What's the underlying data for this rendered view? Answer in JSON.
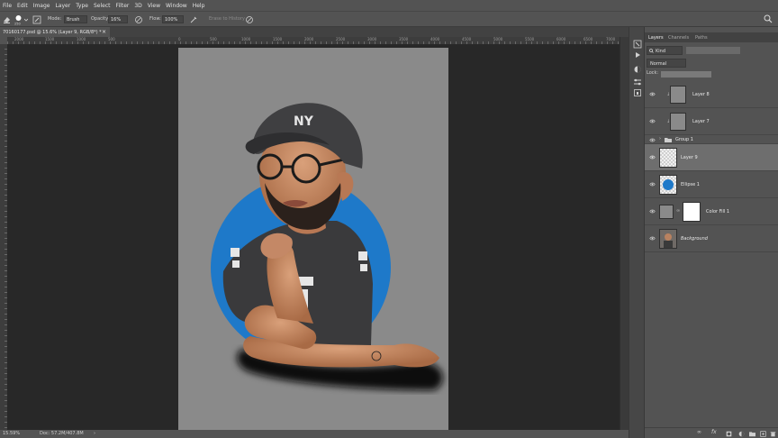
{
  "menu": [
    "File",
    "Edit",
    "Image",
    "Layer",
    "Type",
    "Select",
    "Filter",
    "3D",
    "View",
    "Window",
    "Help"
  ],
  "options_bar": {
    "brush_size": "250",
    "mode_label": "Mode:",
    "mode_value": "Brush",
    "opacity_label": "Opacity:",
    "opacity_value": "16%",
    "flow_label": "Flow:",
    "flow_value": "100%",
    "erase_to_history": "Erase to History"
  },
  "document": {
    "tab_title": "70160177.psd @ 15.6% (Layer 9, RGB/8*) *",
    "ruler_labels": [
      "2000",
      "1500",
      "1000",
      "500",
      "0",
      "500",
      "1000",
      "1500",
      "2000",
      "2500",
      "3000",
      "3500",
      "4000",
      "4500",
      "5000",
      "5500",
      "6000",
      "6500",
      "7000"
    ]
  },
  "status_bar": {
    "zoom": "15.59%",
    "doc_info": "Doc: 57.2M/407.8M"
  },
  "layers_panel": {
    "tabs": [
      "Layers",
      "Channels",
      "Paths"
    ],
    "active_tab": "Layers",
    "kind_label": "Kind",
    "blend_mode": "Normal",
    "lock_label": "Lock:",
    "layers": [
      {
        "name": "Layer 8",
        "type": "layer",
        "selected": false
      },
      {
        "name": "Layer 7",
        "type": "layer",
        "selected": false
      },
      {
        "name": "Group 1",
        "type": "group",
        "selected": false
      },
      {
        "name": "Layer 9",
        "type": "layer",
        "selected": true
      },
      {
        "name": "Ellipse 1",
        "type": "shape",
        "selected": false
      },
      {
        "name": "Color Fill 1",
        "type": "fill",
        "selected": false
      },
      {
        "name": "Background",
        "type": "background",
        "selected": false
      }
    ]
  },
  "colors": {
    "ui_bg": "#535353",
    "canvas_bg": "#282828",
    "artboard": "#8a8a8a",
    "ellipse_blue": "#1e79c9",
    "selected_layer": "#6e6e6e"
  }
}
